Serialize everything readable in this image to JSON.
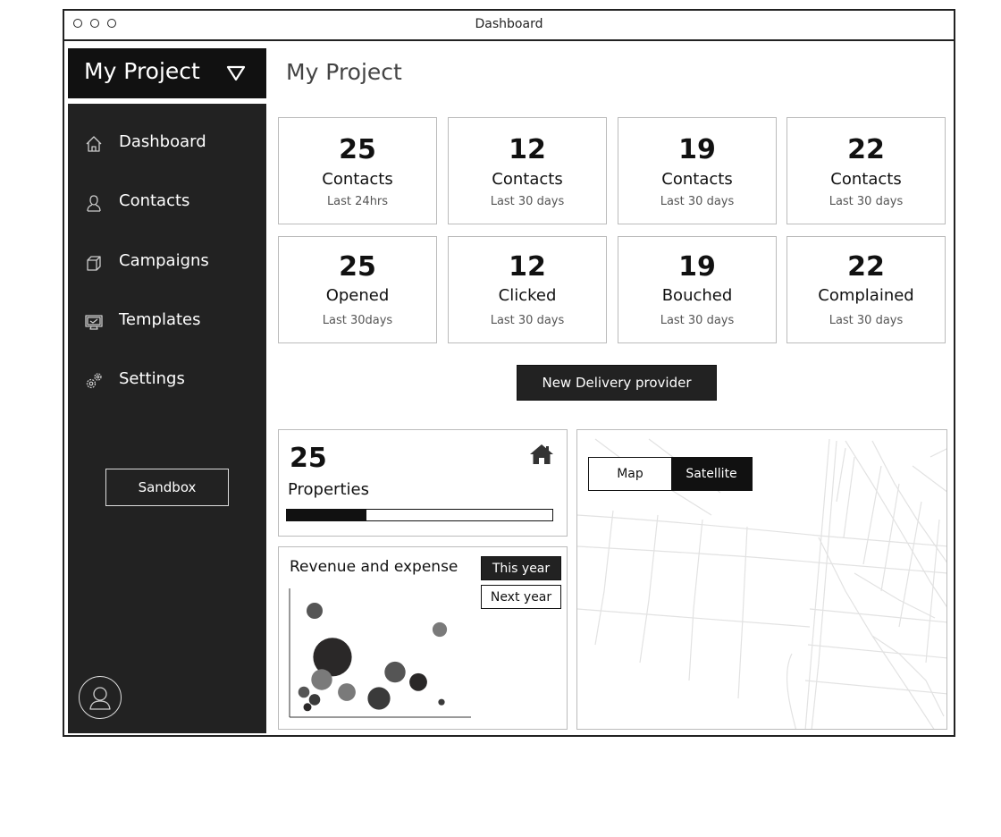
{
  "window": {
    "title": "Dashboard"
  },
  "project": {
    "name": "My Project"
  },
  "sidebar": {
    "items": [
      {
        "label": "Dashboard",
        "icon": "home-icon"
      },
      {
        "label": "Contacts",
        "icon": "user-icon"
      },
      {
        "label": "Campaigns",
        "icon": "box-icon"
      },
      {
        "label": "Templates",
        "icon": "monitor-icon"
      },
      {
        "label": "Settings",
        "icon": "gears-icon"
      }
    ],
    "sandbox_label": "Sandbox"
  },
  "page": {
    "title": "My Project"
  },
  "stats": [
    {
      "value": "25",
      "label": "Contacts",
      "period": "Last 24hrs"
    },
    {
      "value": "12",
      "label": "Contacts",
      "period": "Last 30 days"
    },
    {
      "value": "19",
      "label": "Contacts",
      "period": "Last 30 days"
    },
    {
      "value": "22",
      "label": "Contacts",
      "period": "Last 30 days"
    },
    {
      "value": "25",
      "label": "Opened",
      "period": "Last 30days"
    },
    {
      "value": "12",
      "label": "Clicked",
      "period": "Last 30 days"
    },
    {
      "value": "19",
      "label": "Bouched",
      "period": "Last 30 days"
    },
    {
      "value": "22",
      "label": "Complained",
      "period": "Last 30 days"
    }
  ],
  "actions": {
    "new_provider": "New Delivery provider"
  },
  "properties": {
    "value": "25",
    "label": "Properties",
    "progress": 0.3
  },
  "chart": {
    "toggle_on": "This year",
    "toggle_off": "Next year"
  },
  "chart_data": {
    "type": "scatter",
    "title": "Revenue and expense",
    "points": [
      {
        "x": 0.13,
        "y": 0.85,
        "r": 0.5
      },
      {
        "x": 0.23,
        "y": 0.48,
        "r": 1.2
      },
      {
        "x": 0.17,
        "y": 0.3,
        "r": 0.65
      },
      {
        "x": 0.13,
        "y": 0.14,
        "r": 0.35
      },
      {
        "x": 0.07,
        "y": 0.2,
        "r": 0.35
      },
      {
        "x": 0.09,
        "y": 0.08,
        "r": 0.25
      },
      {
        "x": 0.31,
        "y": 0.2,
        "r": 0.55
      },
      {
        "x": 0.49,
        "y": 0.15,
        "r": 0.7
      },
      {
        "x": 0.58,
        "y": 0.36,
        "r": 0.65
      },
      {
        "x": 0.71,
        "y": 0.28,
        "r": 0.55
      },
      {
        "x": 0.83,
        "y": 0.7,
        "r": 0.45
      },
      {
        "x": 0.84,
        "y": 0.12,
        "r": 0.2
      }
    ],
    "colors": [
      "#555555",
      "#2a2828",
      "#7a7a7a",
      "#3a3a3a"
    ]
  },
  "map": {
    "tabs": [
      "Map",
      "Satellite"
    ],
    "active": "Satellite"
  }
}
